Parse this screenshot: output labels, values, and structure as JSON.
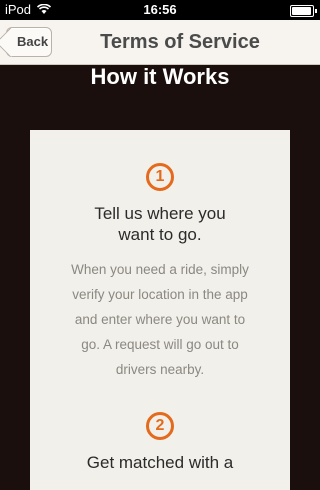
{
  "status_bar": {
    "carrier": "iPod",
    "time": "16:56"
  },
  "nav": {
    "back_label": "Back",
    "title": "Terms of Service"
  },
  "heading": "How it Works",
  "steps": [
    {
      "number": "1",
      "title_line1": "Tell us where you",
      "title_line2": "want to go.",
      "body_lines": [
        "When you need a ride, simply",
        "verify your location in the app",
        "and enter where you want to",
        "go. A request will go out to",
        "drivers nearby."
      ]
    },
    {
      "number": "2",
      "title_line1": "Get matched with a",
      "title_line2": ""
    }
  ],
  "colors": {
    "accent": "#e46b1d",
    "background": "#1a0f0c",
    "card": "#f2f0ea",
    "navbar": "#f7f4ef"
  }
}
